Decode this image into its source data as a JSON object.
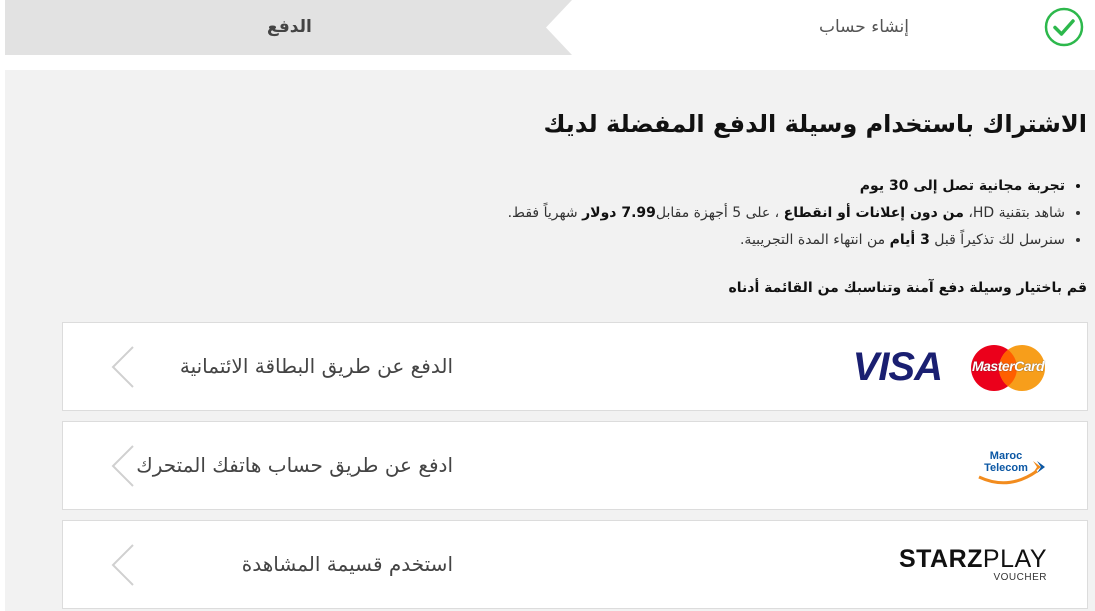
{
  "steps": [
    {
      "label": "إنشاء حساب",
      "status": "completed"
    },
    {
      "label": "الدفع",
      "status": "current"
    }
  ],
  "content": {
    "title": "الاشتراك باستخدام وسيلة الدفع المفضلة لديك",
    "bullets": {
      "b1": "تجربة مجانية تصل إلى 30 يوم",
      "b2_part1": "شاهد بتقنية HD، ",
      "b2_bold1": "من دون إعلانات أو انقطاع",
      "b2_part2": " ، على 5 أجهزة مقابل",
      "b2_bold2": "7.99 دولار",
      "b2_part3": " شهرياً فقط.",
      "b3_part1": "سنرسل لك تذكيراً قبل ",
      "b3_bold": "3 أيام",
      "b3_part2": " من انتهاء المدة التجريبية."
    },
    "instruction": "قم باختيار وسيلة دفع آمنة وتناسبك من القائمة أدناه"
  },
  "payment_options": [
    {
      "label": "الدفع عن طريق البطاقة الائتمانية",
      "logos": [
        "mastercard-logo",
        "visa-logo"
      ],
      "visa_text": "VISA",
      "mastercard_text": "MasterCard"
    },
    {
      "label": "ادفع عن طريق حساب هاتفك المتحرك",
      "logos": [
        "maroc-telecom-logo"
      ],
      "logo_line1": "Maroc",
      "logo_line2": "Telecom"
    },
    {
      "label": "استخدم قسيمة المشاهدة",
      "logos": [
        "starzplay-voucher-logo"
      ],
      "logo_bold": "STARZ",
      "logo_light": "PLAY",
      "logo_sub": "VOUCHER"
    }
  ],
  "colors": {
    "check_green": "#2db84c",
    "step_bar": "#e2e2e2",
    "panel_bg": "#f2f2f2",
    "visa_blue": "#1a1f71",
    "mastercard_red": "#eb001b",
    "mastercard_yellow": "#f79e1b"
  }
}
